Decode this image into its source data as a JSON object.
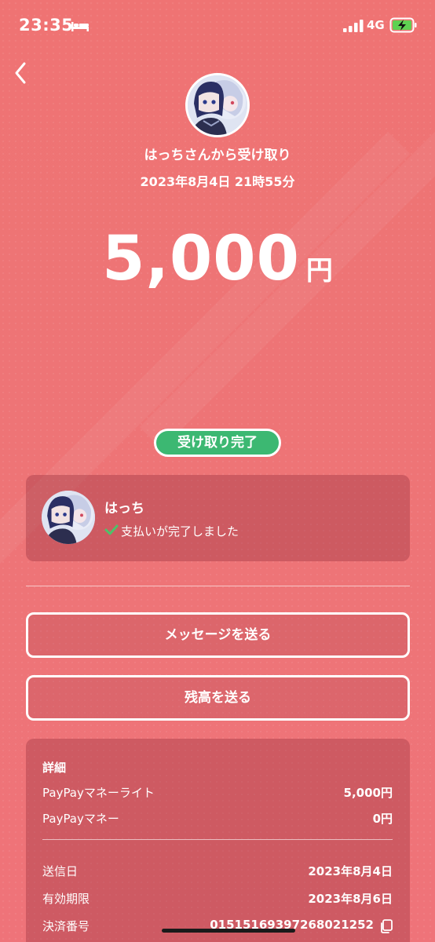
{
  "status_bar": {
    "time": "23:35",
    "network": "4G",
    "icons": [
      "bed-icon",
      "signal-icon",
      "battery-charging-icon"
    ]
  },
  "header": {
    "back_icon": "chevron-left-icon",
    "title": "はっちさんから受け取り",
    "date": "2023年8月4日 21時55分"
  },
  "amount": {
    "value": "5,000",
    "unit": "円"
  },
  "status_badge": "受け取り完了",
  "payer": {
    "name": "はっち",
    "status": "支払いが完了しました",
    "status_icon": "check-icon"
  },
  "actions": {
    "message_button": "メッセージを送る",
    "balance_button": "残高を送る"
  },
  "details": {
    "title": "詳細",
    "money_rows": [
      {
        "label": "PayPayマネーライト",
        "value": "5,000円"
      },
      {
        "label": "PayPayマネー",
        "value": "0円"
      }
    ],
    "info_rows": [
      {
        "label": "送信日",
        "value": "2023年8月4日"
      },
      {
        "label": "有効期限",
        "value": "2023年8月6日"
      },
      {
        "label": "決済番号",
        "value": "01515169397268021252"
      }
    ]
  },
  "colors": {
    "background": "#ee7476",
    "badge": "#3cb872",
    "check": "#4cc36a"
  }
}
